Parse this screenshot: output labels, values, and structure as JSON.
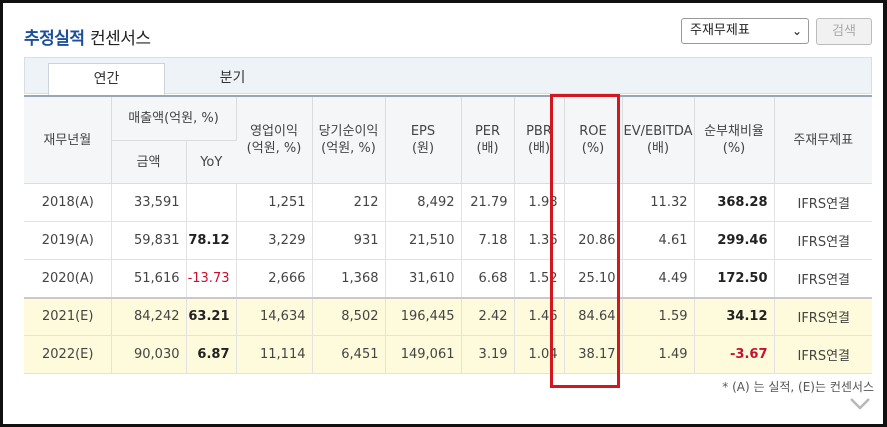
{
  "header": {
    "title_accent": "추정실적",
    "title_rest": "컨센서스"
  },
  "controls": {
    "select_value": "주재무제표",
    "search_label": "검색"
  },
  "tabs": [
    {
      "label": "연간",
      "active": true
    },
    {
      "label": "분기",
      "active": false
    }
  ],
  "table": {
    "headers": {
      "period": "재무년월",
      "sales": "매출액(억원, %)",
      "sales_amount": "금액",
      "sales_yoy": "YoY",
      "op_income": "영업이익",
      "op_income_unit": "(억원, %)",
      "net_income": "당기순이익",
      "net_income_unit": "(억원, %)",
      "eps": "EPS",
      "eps_unit": "(원)",
      "per": "PER",
      "per_unit": "(배)",
      "pbr": "PBR",
      "pbr_unit": "(배)",
      "roe": "ROE",
      "roe_unit": "(%)",
      "ev_ebitda": "EV/EBITDA",
      "ev_ebitda_unit": "(배)",
      "net_debt": "순부채비율",
      "net_debt_unit": "(%)",
      "statement": "주재무제표"
    },
    "rows": [
      {
        "period": "2018(A)",
        "amount": "33,591",
        "yoy": "",
        "op": "1,251",
        "net": "212",
        "eps": "8,492",
        "per": "21.79",
        "pbr": "1.98",
        "roe": "",
        "ev": "11.32",
        "debt": "368.28",
        "stmt": "IFRS연결"
      },
      {
        "period": "2019(A)",
        "amount": "59,831",
        "yoy": "78.12",
        "op": "3,229",
        "net": "931",
        "eps": "21,510",
        "per": "7.18",
        "pbr": "1.36",
        "roe": "20.86",
        "ev": "4.61",
        "debt": "299.46",
        "stmt": "IFRS연결"
      },
      {
        "period": "2020(A)",
        "amount": "51,616",
        "yoy": "-13.73",
        "op": "2,666",
        "net": "1,368",
        "eps": "31,610",
        "per": "6.68",
        "pbr": "1.52",
        "roe": "25.10",
        "ev": "4.49",
        "debt": "172.50",
        "stmt": "IFRS연결"
      },
      {
        "period": "2021(E)",
        "amount": "84,242",
        "yoy": "63.21",
        "op": "14,634",
        "net": "8,502",
        "eps": "196,445",
        "per": "2.42",
        "pbr": "1.46",
        "roe": "84.64",
        "ev": "1.59",
        "debt": "34.12",
        "stmt": "IFRS연결"
      },
      {
        "period": "2022(E)",
        "amount": "90,030",
        "yoy": "6.87",
        "op": "11,114",
        "net": "6,451",
        "eps": "149,061",
        "per": "3.19",
        "pbr": "1.04",
        "roe": "38.17",
        "ev": "1.49",
        "debt": "-3.67",
        "stmt": "IFRS연결"
      }
    ]
  },
  "footnote": "* (A) 는 실적, (E)는 컨센서스",
  "colors": {
    "accent": "#1b4f9c",
    "estimate_row_bg": "#fdfbdc",
    "negative": "#c8102e",
    "highlight_box": "#d4171e"
  }
}
